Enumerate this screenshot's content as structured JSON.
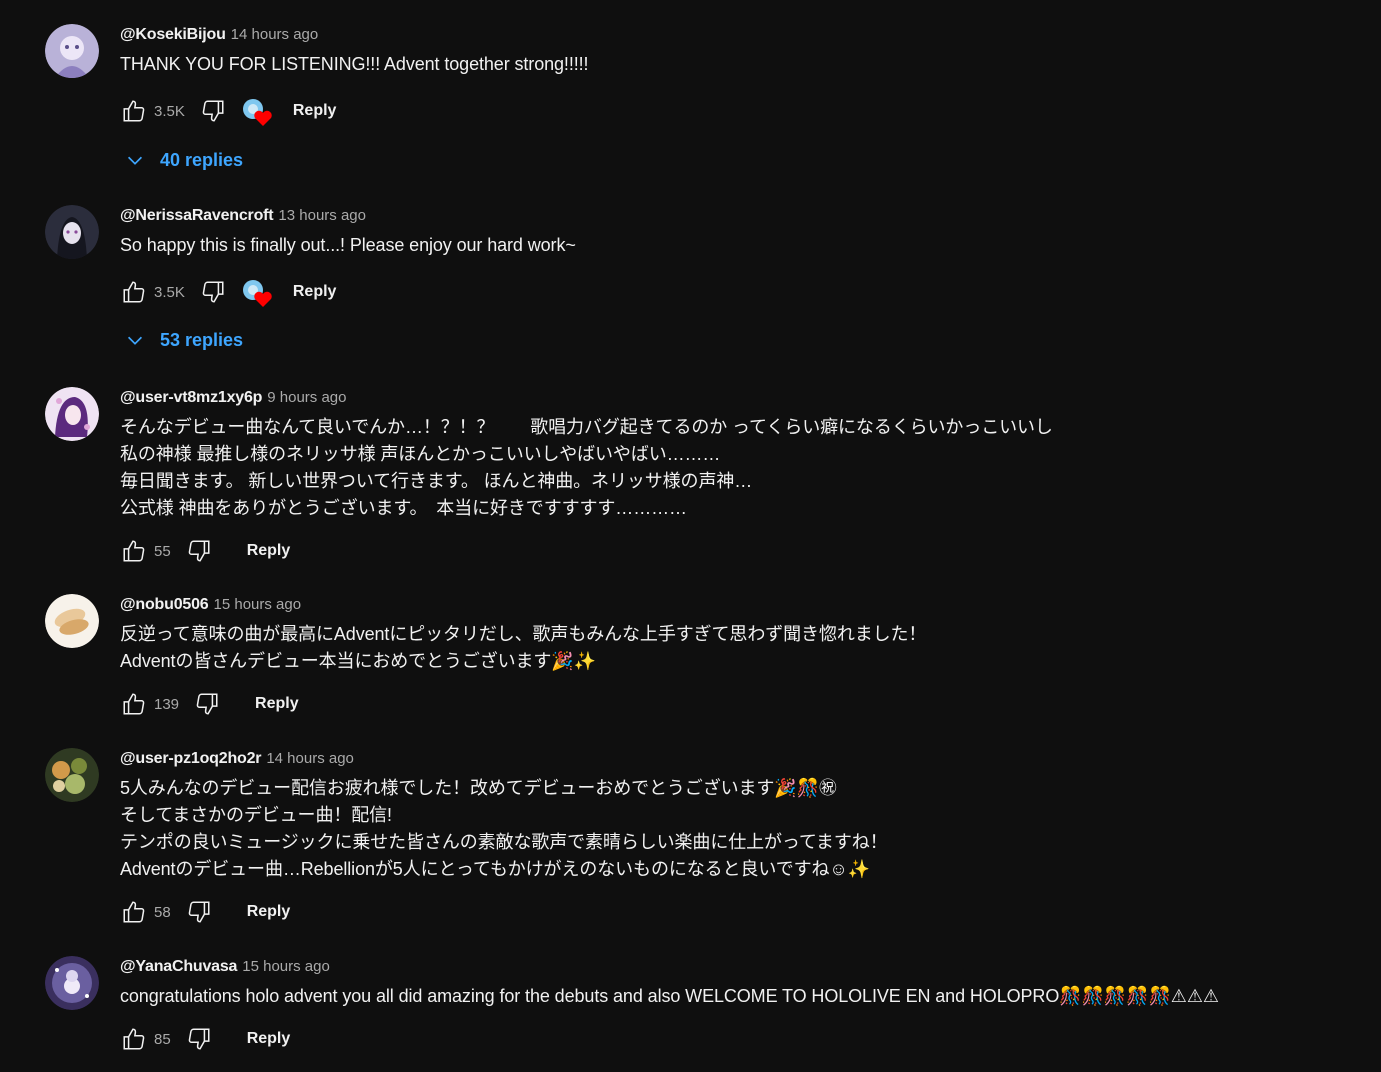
{
  "comments": [
    {
      "author": "@KosekiBijou",
      "time": "14 hours ago",
      "lines": [
        "THANK YOU FOR LISTENING!!! Advent together strong!!!!!"
      ],
      "likes": "3.5K",
      "reply_label": "Reply",
      "creator_heart": true,
      "replies_label": "40 replies",
      "avatar_colors": [
        "#c9c3e6",
        "#7b6fa8"
      ]
    },
    {
      "author": "@NerissaRavencroft",
      "time": "13 hours ago",
      "lines": [
        "So happy this is finally out...! Please enjoy our hard work~"
      ],
      "likes": "3.5K",
      "reply_label": "Reply",
      "creator_heart": true,
      "replies_label": "53 replies",
      "avatar_colors": [
        "#2a2a3a",
        "#8da0c8"
      ]
    },
    {
      "author": "@user-vt8mz1xy6p",
      "time": "9 hours ago",
      "lines": [
        "そんなデビュー曲なんて良いでんか…！？！？　　歌唱力バグ起きてるのか ってくらい癖になるくらいかっこいいし",
        "私の神様 最推し様のネリッサ様 声ほんとかっこいいしやばいやばい………",
        "毎日聞きます。 新しい世界ついて行きます。 ほんと神曲。ネリッサ様の声神…",
        "公式様 神曲をありがとうございます。　本当に好きですすすす…………"
      ],
      "likes": "55",
      "reply_label": "Reply",
      "creator_heart": false,
      "avatar_colors": [
        "#e8d6f0",
        "#5a2a7a"
      ]
    },
    {
      "author": "@nobu0506",
      "time": "15 hours ago",
      "lines": [
        "反逆って意味の曲が最高にAdventにピッタリだし、歌声もみんな上手すぎて思わず聞き惚れました！",
        "Adventの皆さんデビュー本当におめでとうございます🎉✨"
      ],
      "likes": "139",
      "reply_label": "Reply",
      "creator_heart": false,
      "avatar_colors": [
        "#f5f0e8",
        "#d9b27a"
      ]
    },
    {
      "author": "@user-pz1oq2ho2r",
      "time": "14 hours ago",
      "lines": [
        "5人みんなのデビュー配信お疲れ様でした！改めてデビューおめでとうございます🎉🎊㊗",
        "そしてまさかのデビュー曲！配信!",
        "テンポの良いミュージックに乗せた皆さんの素敵な歌声で素晴らしい楽曲に仕上がってますね！",
        "Adventのデビュー曲…Rebellionが5人にとってもかけがえのないものになると良いですね☺✨"
      ],
      "likes": "58",
      "reply_label": "Reply",
      "creator_heart": false,
      "avatar_colors": [
        "#6b7a3a",
        "#d0a060"
      ]
    },
    {
      "author": "@YanaChuvasa",
      "time": "15 hours ago",
      "lines": [
        "congratulations holo advent you all did amazing for the debuts and also WELCOME TO HOLOLIVE EN and HOLOPRO🎊🎊🎊🎊🎊⚠⚠⚠"
      ],
      "likes": "85",
      "reply_label": "Reply",
      "creator_heart": false,
      "avatar_colors": [
        "#3a2a5a",
        "#d8d0f0"
      ]
    }
  ],
  "colors": {
    "background": "#0f0f0f",
    "text": "#f1f1f1",
    "secondary_text": "#aaaaaa",
    "link_blue": "#3ea6ff",
    "heart_red": "#ff0000"
  },
  "icons": {
    "like": "thumb-up-icon",
    "dislike": "thumb-down-icon",
    "heart": "creator-heart-icon",
    "expand": "chevron-down-icon"
  }
}
